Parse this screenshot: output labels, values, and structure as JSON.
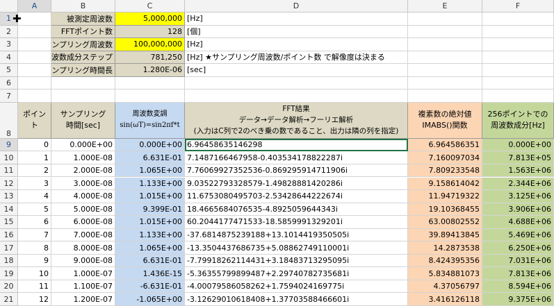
{
  "columns": [
    "A",
    "B",
    "C",
    "D",
    "E",
    "F"
  ],
  "params": [
    {
      "row": "1",
      "label": "被測定周波数",
      "value": "5,000,000",
      "unit": "[Hz]",
      "highlight": true
    },
    {
      "row": "2",
      "label": "FFTポイント数",
      "value": "128",
      "unit": "[個]",
      "highlight": false
    },
    {
      "row": "3",
      "label": "サンプリング周波数",
      "value": "100,000,000",
      "unit": "[Hz]",
      "highlight": true
    },
    {
      "row": "4",
      "label": "周波数成分ステップ",
      "value": "781,250",
      "unit": "[Hz] ★サンプリング周波数/ポイント数 で解像度は決まる",
      "highlight": false
    },
    {
      "row": "5",
      "label": "サンプリング時間長",
      "value": "1.280E-06",
      "unit": "[sec]",
      "highlight": false
    }
  ],
  "empty_rows": [
    "6",
    "7"
  ],
  "header_row": {
    "row": "8",
    "a": "ポイント",
    "b": [
      "サンプリング",
      "時間[sec]"
    ],
    "c": [
      "周波数変調",
      "sin(ωT)=sin2πf*t"
    ],
    "d": [
      "FFT結果",
      "データ→データ解析→フーリエ解析",
      "(入力はC列で2のべき乗の数であること、出力は隣の列を指定)"
    ],
    "e": [
      "複素数の絶対値",
      "IMABS()関数"
    ],
    "f": [
      "256ポイントでの",
      "周波数成分[Hz]"
    ]
  },
  "data_rows": [
    {
      "row": "9",
      "a": "0",
      "b": "0.000E+00",
      "c": "0.000E+00",
      "d": "6.96458635146298",
      "e": "6.964586351",
      "f": "0.000E+00"
    },
    {
      "row": "10",
      "a": "1",
      "b": "1.000E-08",
      "c": "6.631E-01",
      "d": "7.1487166467958-0.403534178822287i",
      "e": "7.160097034",
      "f": "7.813E+05"
    },
    {
      "row": "11",
      "a": "2",
      "b": "2.000E-08",
      "c": "1.065E+00",
      "d": "7.76069927352536-0.869295914711906i",
      "e": "7.809233548",
      "f": "1.563E+06"
    },
    {
      "row": "12",
      "a": "3",
      "b": "3.000E-08",
      "c": "1.133E+00",
      "d": "9.03522793328579-1.49828881420286i",
      "e": "9.158614042",
      "f": "2.344E+06"
    },
    {
      "row": "13",
      "a": "4",
      "b": "4.000E-08",
      "c": "1.015E+00",
      "d": "11.6753080495703-2.53428644222674i",
      "e": "11.94719322",
      "f": "3.125E+06"
    },
    {
      "row": "14",
      "a": "5",
      "b": "5.000E-08",
      "c": "9.399E-01",
      "d": "18.4665684076535-4.8925059644343i",
      "e": "19.10368455",
      "f": "3.906E+06"
    },
    {
      "row": "15",
      "a": "6",
      "b": "6.000E-08",
      "c": "1.015E+00",
      "d": "60.2044177471533-18.5859991329201i",
      "e": "63.00802552",
      "f": "4.688E+06"
    },
    {
      "row": "16",
      "a": "7",
      "b": "7.000E-08",
      "c": "1.133E+00",
      "d": "-37.6814875239188+13.1014419350505i",
      "e": "39.89413845",
      "f": "5.469E+06"
    },
    {
      "row": "17",
      "a": "8",
      "b": "8.000E-08",
      "c": "1.065E+00",
      "d": "-13.3504437686735+5.08862749110001i",
      "e": "14.2873538",
      "f": "6.250E+06"
    },
    {
      "row": "18",
      "a": "9",
      "b": "9.000E-08",
      "c": "6.631E-01",
      "d": "-7.79918262114431+3.18483713295095i",
      "e": "8.424395356",
      "f": "7.031E+06"
    },
    {
      "row": "19",
      "a": "10",
      "b": "1.000E-07",
      "c": "1.436E-15",
      "d": "-5.36355799899487+2.29740782735681i",
      "e": "5.834881073",
      "f": "7.813E+06"
    },
    {
      "row": "20",
      "a": "11",
      "b": "1.100E-07",
      "c": "-6.631E-01",
      "d": "-4.00079586058262+1.7594024169775i",
      "e": "4.37056797",
      "f": "8.594E+06"
    },
    {
      "row": "21",
      "a": "12",
      "b": "1.200E-07",
      "c": "-1.065E+00",
      "d": "-3.12629010618408+1.37703588466601i",
      "e": "3.416126118",
      "f": "9.375E+06"
    }
  ]
}
